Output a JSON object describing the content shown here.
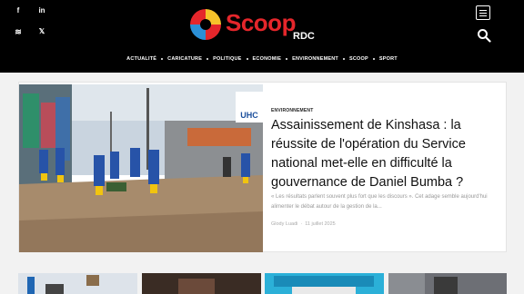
{
  "header": {
    "logo_main": "Scoop",
    "logo_sub": "RDC",
    "social": [
      {
        "name": "facebook-icon",
        "glyph": "f"
      },
      {
        "name": "linkedin-icon",
        "glyph": "in"
      },
      {
        "name": "rss-icon",
        "glyph": "≋"
      },
      {
        "name": "x-icon",
        "glyph": "𝕏"
      }
    ],
    "nav": [
      "ACTUALITÉ",
      "CARICATURE",
      "POLITIQUE",
      "ECONOMIE",
      "ENVIRONNEMENT",
      "SCOOP",
      "SPORT"
    ]
  },
  "featured": {
    "category": "ENVIRONNEMENT",
    "title": "Assainissement de Kinshasa : la réussite de l'opération du Service national met-elle en difficulté la gouvernance de Daniel Bumba ?",
    "excerpt": "« Les résultats parlent souvent plus fort que les discours ». Cet adage semble aujourd'hui alimenter le débat autour de la gestion de la...",
    "author": "Glody Luadi",
    "date": "11 juillet 2025",
    "image_sign": "UHC"
  },
  "colors": {
    "topbar": "#000000",
    "logo_red": "#e5262b",
    "card_bg": "#ffffff",
    "page_bg": "#f2f2f2"
  }
}
